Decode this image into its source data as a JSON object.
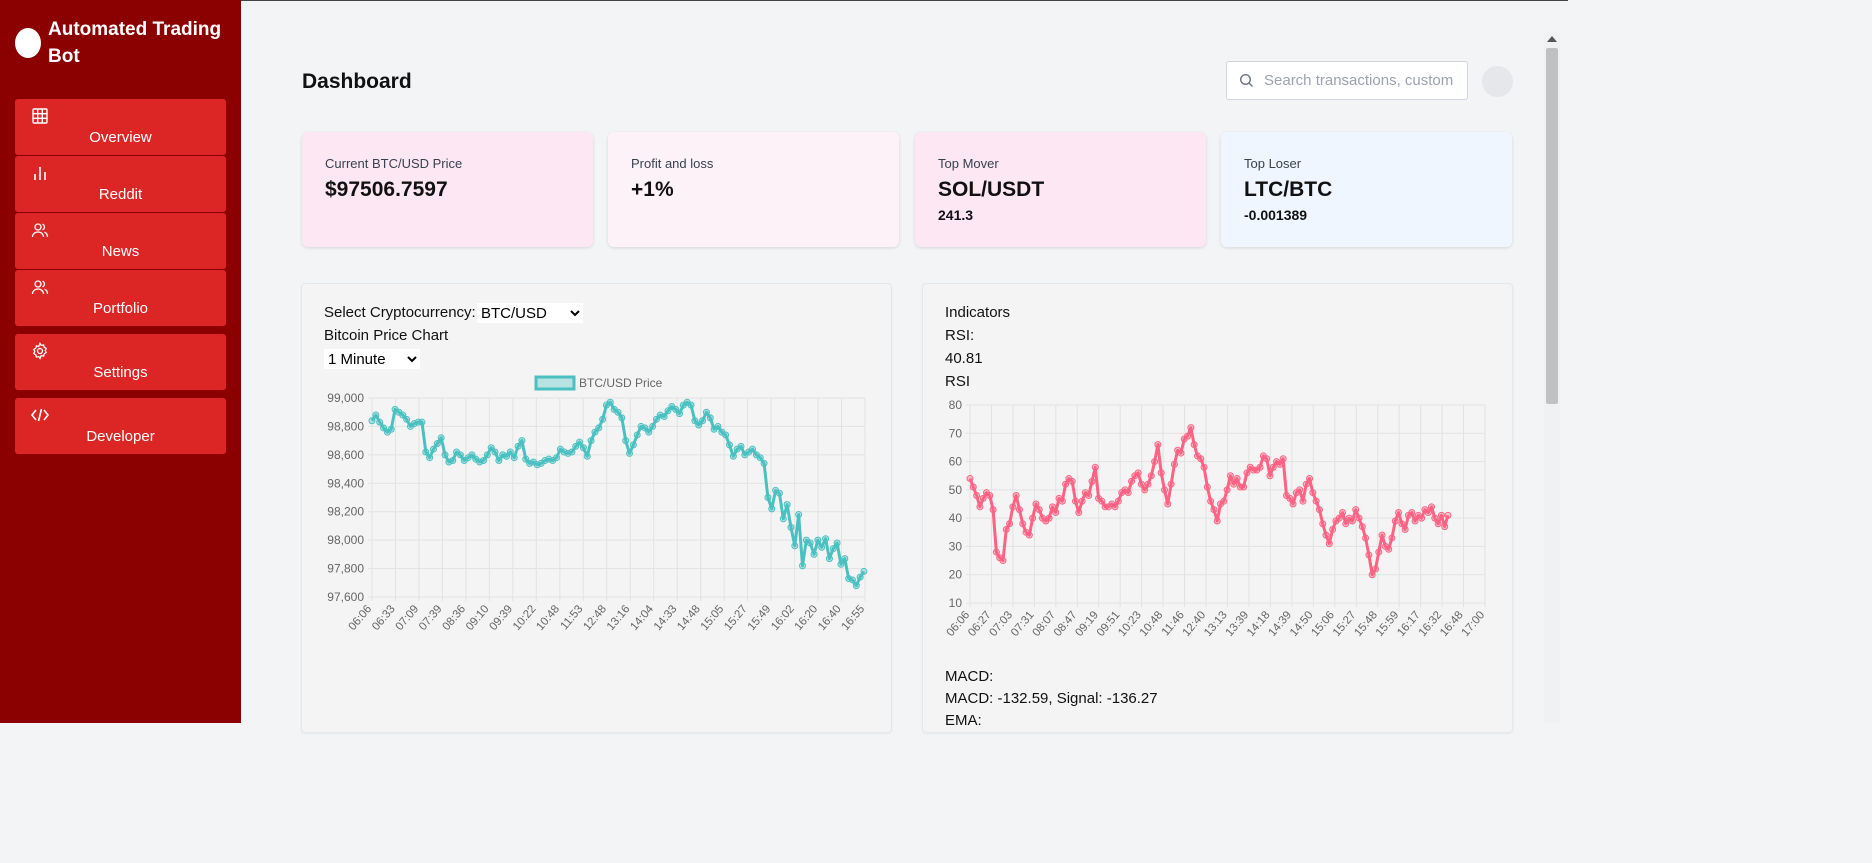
{
  "brand": {
    "title": "Automated Trading Bot"
  },
  "nav": [
    {
      "label": "Overview",
      "icon": "grid-icon"
    },
    {
      "label": "Reddit",
      "icon": "bar-chart-icon"
    },
    {
      "label": "News",
      "icon": "users-icon"
    },
    {
      "label": "Portfolio",
      "icon": "users-icon"
    },
    {
      "label": "Settings",
      "icon": "gear-icon"
    },
    {
      "label": "Developer",
      "icon": "code-icon"
    }
  ],
  "header": {
    "title": "Dashboard",
    "search_placeholder": "Search transactions, customers..."
  },
  "cards": [
    {
      "label": "Current BTC/USD Price",
      "value": "$97506.7597",
      "sub": "",
      "bg": "#fce7f3"
    },
    {
      "label": "Profit and loss",
      "value": "+1%",
      "sub": "",
      "bg": "#fdf2f8"
    },
    {
      "label": "Top Mover",
      "value": "SOL/USDT",
      "sub": "241.3",
      "bg": "#fce7f3"
    },
    {
      "label": "Top Loser",
      "value": "LTC/BTC",
      "sub": "-0.001389",
      "bg": "#eff6ff"
    }
  ],
  "price_panel": {
    "select_label": "Select Cryptocurrency:",
    "crypto_selected": "BTC/USD",
    "chart_title": "Bitcoin Price Chart",
    "interval_selected": "1 Minute"
  },
  "indicators_panel": {
    "title": "Indicators",
    "rsi_label": "RSI:",
    "rsi_value": "40.81",
    "rsi_chart_label": "RSI",
    "macd_label": "MACD:",
    "macd_value": "MACD: -132.59, Signal: -136.27",
    "ema_label": "EMA:"
  },
  "colors": {
    "sidebar": "#8b0000",
    "nav_item": "#dc2626",
    "price_line": "#4bc0c0",
    "rsi_line": "#ff6384"
  },
  "chart_data": [
    {
      "type": "line",
      "legend": "BTC/USD Price",
      "ylim": [
        97600,
        99000
      ],
      "yticks": [
        "99,000",
        "98,800",
        "98,600",
        "98,400",
        "98,200",
        "98,000",
        "97,800",
        "97,600"
      ],
      "xticks": [
        "06:06",
        "06:33",
        "07:09",
        "07:39",
        "08:36",
        "09:10",
        "09:39",
        "10:22",
        "10:48",
        "11:53",
        "12:48",
        "13:16",
        "14:04",
        "14:33",
        "14:48",
        "15:05",
        "15:27",
        "15:49",
        "16:02",
        "16:20",
        "16:40",
        "16:55"
      ],
      "series": [
        {
          "name": "BTC/USD Price",
          "values": [
            98840,
            98880,
            98830,
            98790,
            98760,
            98780,
            98920,
            98900,
            98880,
            98850,
            98800,
            98820,
            98830,
            98830,
            98620,
            98580,
            98640,
            98680,
            98720,
            98600,
            98550,
            98560,
            98620,
            98600,
            98560,
            98580,
            98600,
            98570,
            98550,
            98560,
            98600,
            98650,
            98620,
            98560,
            98600,
            98590,
            98620,
            98580,
            98660,
            98700,
            98570,
            98540,
            98550,
            98530,
            98540,
            98560,
            98570,
            98560,
            98580,
            98640,
            98620,
            98610,
            98620,
            98660,
            98690,
            98650,
            98590,
            98700,
            98760,
            98790,
            98850,
            98950,
            98970,
            98920,
            98900,
            98860,
            98700,
            98610,
            98670,
            98740,
            98800,
            98790,
            98760,
            98800,
            98850,
            98880,
            98870,
            98910,
            98940,
            98920,
            98890,
            98950,
            98970,
            98950,
            98840,
            98810,
            98840,
            98900,
            98860,
            98780,
            98800,
            98760,
            98740,
            98670,
            98590,
            98640,
            98660,
            98600,
            98620,
            98640,
            98600,
            98580,
            98540,
            98300,
            98220,
            98350,
            98330,
            98150,
            98250,
            98090,
            97960,
            98180,
            97820,
            98000,
            97980,
            97900,
            98000,
            97950,
            98010,
            97870,
            97940,
            97980,
            97830,
            97870,
            97730,
            97720,
            97680,
            97740,
            97780
          ]
        }
      ]
    },
    {
      "type": "line",
      "legend": "RSI",
      "ylim": [
        10,
        80
      ],
      "yticks": [
        "80",
        "70",
        "60",
        "50",
        "40",
        "30",
        "20",
        "10"
      ],
      "xticks": [
        "06:06",
        "06:27",
        "07:03",
        "07:31",
        "08:07",
        "08:47",
        "09:19",
        "09:51",
        "10:23",
        "10:48",
        "11:46",
        "12:40",
        "13:13",
        "13:39",
        "14:18",
        "14:39",
        "14:50",
        "15:06",
        "15:27",
        "15:48",
        "15:59",
        "16:17",
        "16:32",
        "16:48",
        "17:00"
      ],
      "series": [
        {
          "name": "RSI",
          "values": [
            54,
            51,
            48,
            44,
            47,
            49,
            48,
            43,
            28,
            26,
            25,
            36,
            38,
            44,
            48,
            43,
            38,
            35,
            34,
            40,
            45,
            43,
            40,
            39,
            40,
            44,
            42,
            47,
            46,
            52,
            54,
            53,
            46,
            42,
            46,
            49,
            48,
            53,
            58,
            47,
            46,
            44,
            44,
            45,
            44,
            46,
            49,
            50,
            49,
            53,
            55,
            56,
            52,
            50,
            52,
            55,
            60,
            66,
            56,
            50,
            45,
            52,
            59,
            64,
            63,
            68,
            69,
            72,
            66,
            62,
            61,
            58,
            51,
            46,
            43,
            39,
            45,
            46,
            50,
            55,
            52,
            54,
            51,
            51,
            56,
            58,
            57,
            57,
            58,
            62,
            61,
            55,
            58,
            60,
            59,
            61,
            48,
            47,
            45,
            49,
            50,
            46,
            52,
            54,
            49,
            46,
            43,
            38,
            34,
            31,
            36,
            39,
            40,
            42,
            38,
            40,
            39,
            43,
            40,
            37,
            33,
            27,
            20,
            22,
            28,
            34,
            30,
            29,
            33,
            39,
            42,
            38,
            36,
            41,
            42,
            39,
            41,
            40,
            43,
            42,
            44,
            40,
            38,
            41,
            37,
            41
          ]
        }
      ]
    }
  ]
}
